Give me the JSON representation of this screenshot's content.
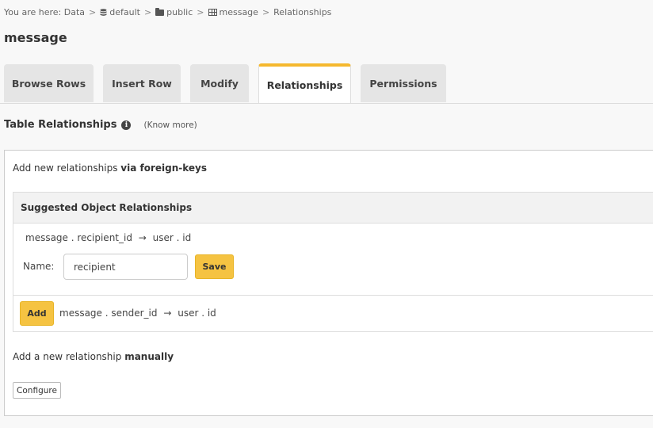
{
  "breadcrumb": {
    "prefix": "You are here:",
    "items": [
      "Data",
      "default",
      "public",
      "message",
      "Relationships"
    ],
    "separator": ">"
  },
  "page": {
    "title": "message"
  },
  "tabs": [
    {
      "label": "Browse Rows",
      "active": false
    },
    {
      "label": "Insert Row",
      "active": false
    },
    {
      "label": "Modify",
      "active": false
    },
    {
      "label": "Relationships",
      "active": true
    },
    {
      "label": "Permissions",
      "active": false
    }
  ],
  "section": {
    "title": "Table Relationships",
    "info_icon": "i",
    "know_more": "(Know more)"
  },
  "panel": {
    "fk_intro": "Add new relationships ",
    "fk_intro_bold": "via foreign-keys",
    "suggested": {
      "header": "Suggested Object Relationships",
      "first": {
        "mapping": "message . recipient_id",
        "arrow": "→",
        "target": "user . id",
        "name_label": "Name:",
        "name_value": "recipient",
        "save_label": "Save"
      },
      "second": {
        "add_label": "Add",
        "mapping": "message . sender_id",
        "arrow": "→",
        "target": "user . id"
      }
    },
    "manual_intro": "Add a new relationship ",
    "manual_bold": "manually",
    "configure_label": "Configure"
  },
  "colors": {
    "accent": "#f5b82e",
    "button": "#f5c342"
  },
  "icons": [
    "database-icon",
    "folder-icon",
    "table-icon",
    "info-icon"
  ]
}
